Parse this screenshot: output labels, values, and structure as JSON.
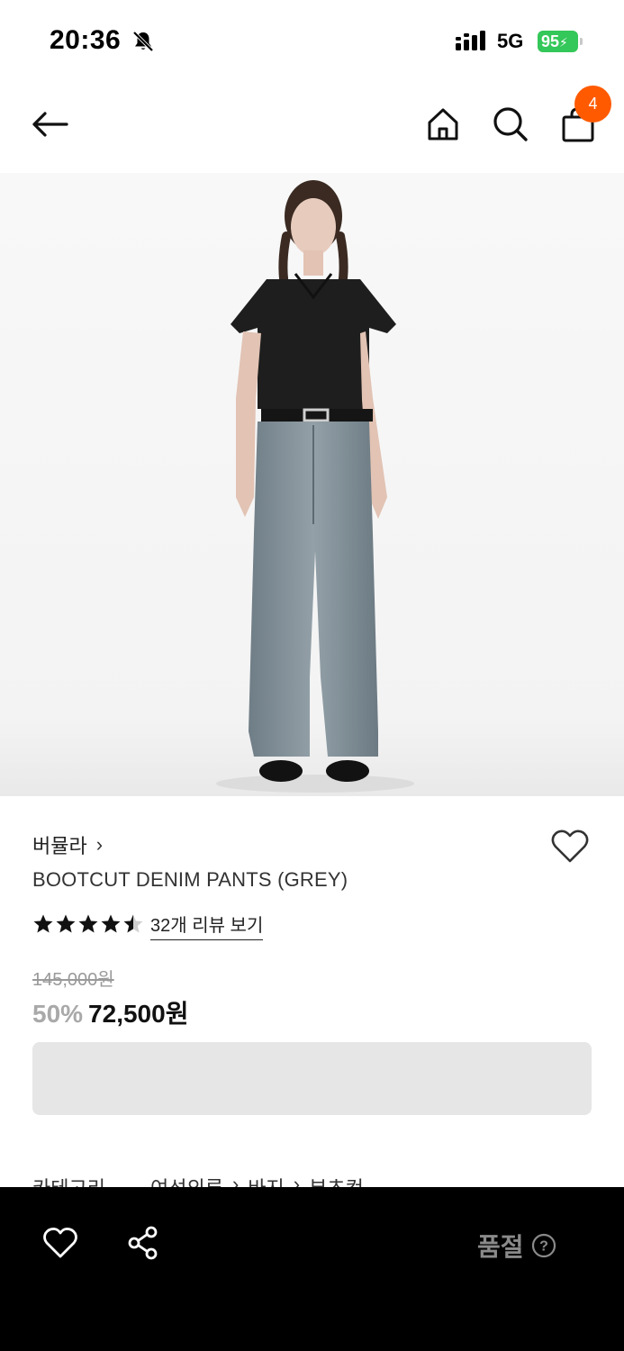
{
  "status_bar": {
    "time": "20:36",
    "network": "5G",
    "battery": "95"
  },
  "header": {
    "cart_count": "4"
  },
  "product": {
    "brand": "버뮬라",
    "brand_chevron": "›",
    "name": "BOOTCUT DENIM PANTS (GREY)",
    "rating": 4.5,
    "review_link": "32개 리뷰 보기",
    "original_price": "145,000원",
    "discount": "50%",
    "sale_price": "72,500원",
    "image_description": "Model wearing black short-sleeve shirt and grey bootcut denim pants"
  },
  "category": {
    "label": "카테고리",
    "path": [
      "여성의류",
      "›",
      "바지",
      "›",
      "부츠컷"
    ]
  },
  "bottom_bar": {
    "status": "품절"
  },
  "icons": {
    "back": "arrow-left-icon",
    "home": "home-icon",
    "search": "search-icon",
    "cart": "shopping-bag-icon",
    "wish": "heart-icon",
    "share": "share-icon",
    "help": "question-circle-icon"
  },
  "colors": {
    "badge": "#ff5a00",
    "battery": "#34c759",
    "bottom_bar": "#000000",
    "option_box": "#e6e6e6"
  }
}
